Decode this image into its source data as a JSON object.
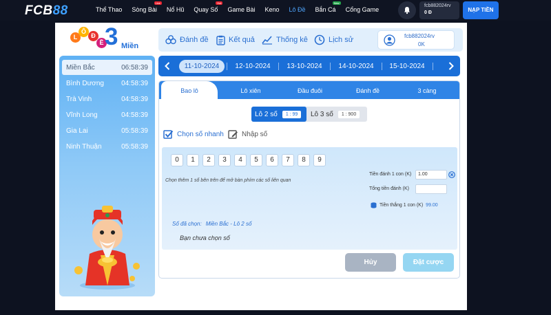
{
  "brand": {
    "logo_main": "FCB",
    "logo_accent": "88"
  },
  "nav": {
    "items": [
      {
        "label": "Thể Thao",
        "tag": ""
      },
      {
        "label": "Sòng Bài",
        "tag": "Live"
      },
      {
        "label": "Nổ Hũ",
        "tag": ""
      },
      {
        "label": "Quay Số",
        "tag": "Hot"
      },
      {
        "label": "Game Bài",
        "tag": ""
      },
      {
        "label": "Keno",
        "tag": ""
      },
      {
        "label": "Lô Đề",
        "tag": ""
      },
      {
        "label": "Bắn Cá",
        "tag": "New"
      },
      {
        "label": "Cổng Game",
        "tag": ""
      }
    ],
    "active_index": 6
  },
  "user": {
    "username": "fcb882024rv",
    "balance": "0 Đ"
  },
  "deposit_label": "NẠP TIỀN",
  "game_logo": {
    "letters": [
      "L",
      "Ô",
      "Đ",
      "Ề"
    ],
    "number": "3",
    "word": "Miền"
  },
  "regions": [
    {
      "name": "Miền Bắc",
      "time": "06:58:39"
    },
    {
      "name": "Bình Dương",
      "time": "04:58:39"
    },
    {
      "name": "Trà Vinh",
      "time": "04:58:39"
    },
    {
      "name": "Vĩnh Long",
      "time": "04:58:39"
    },
    {
      "name": "Gia Lai",
      "time": "05:58:39"
    },
    {
      "name": "Ninh Thuận",
      "time": "05:58:39"
    }
  ],
  "header_tabs": {
    "bet": "Đánh đề",
    "results": "Kết quả",
    "stats": "Thống kê",
    "history": "Lịch sử"
  },
  "account_card": {
    "username": "fcb882024rv",
    "balance": "0K"
  },
  "dates": [
    "11-10-2024",
    "12-10-2024",
    "13-10-2024",
    "14-10-2024",
    "15-10-2024"
  ],
  "bet_tabs": [
    "Bao lô",
    "Lô xiên",
    "Đầu đuôi",
    "Đánh đề",
    "3 càng"
  ],
  "lo_options": [
    {
      "label": "Lô 2 số",
      "rate": "1 : 99"
    },
    {
      "label": "Lô 3 số",
      "rate": "1 : 900"
    }
  ],
  "modes": {
    "quick": "Chọn số nhanh",
    "manual": "Nhập số"
  },
  "numbers": [
    "0",
    "1",
    "2",
    "3",
    "4",
    "5",
    "6",
    "7",
    "8",
    "9"
  ],
  "hint": "Chọn thêm 1 số bên trên để mở bàn phím các số liên quan",
  "fields": {
    "unit_label": "Tiền đánh 1 con (K)",
    "unit_value": "1.00",
    "total_label": "Tổng tiền đánh (K)",
    "total_value": "",
    "win_label": "Tiền thắng 1 con (K)",
    "win_value": "99.00"
  },
  "selection": {
    "label": "Số đã chọn:",
    "value": "Miền Bắc - Lô 2 số",
    "empty": "Bạn chưa chọn số"
  },
  "actions": {
    "cancel": "Hủy",
    "place": "Đặt cược"
  },
  "colors": {
    "primary": "#1a6fd8",
    "accent": "#4fa6ff",
    "live_tag": "#e8232f",
    "new_tag": "#23a44a"
  }
}
